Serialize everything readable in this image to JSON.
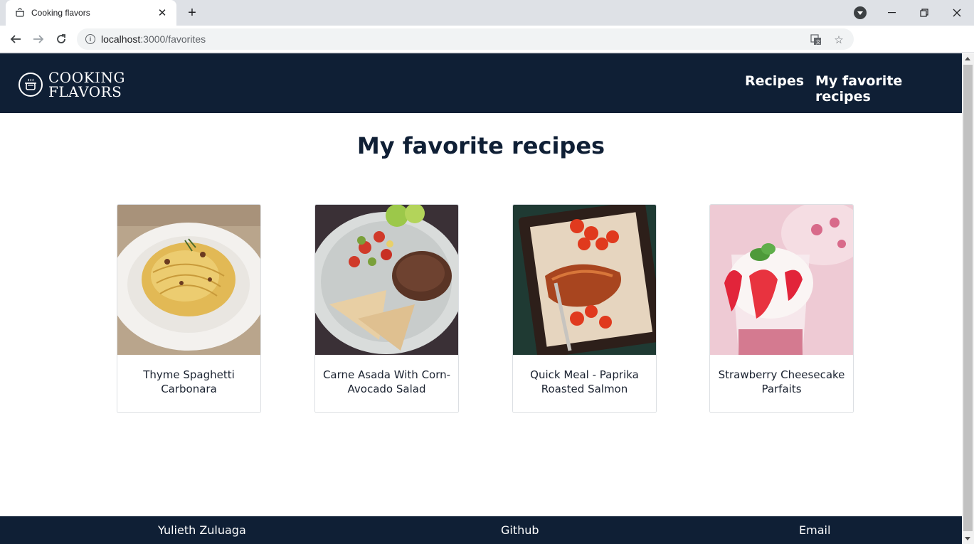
{
  "browser": {
    "tab_title": "Cooking flavors",
    "url_host": "localhost",
    "url_path": ":3000/favorites"
  },
  "header": {
    "logo_line1": "COOKING",
    "logo_line2": "FLAVORS",
    "nav": [
      "Recipes",
      "My favorite recipes"
    ]
  },
  "main": {
    "title": "My favorite recipes",
    "recipes": [
      {
        "name": "Thyme Spaghetti Carbonara"
      },
      {
        "name": "Carne Asada With Corn-Avocado Salad"
      },
      {
        "name": "Quick Meal - Paprika Roasted Salmon"
      },
      {
        "name": "Strawberry Cheesecake Parfaits"
      }
    ]
  },
  "footer": {
    "author": "Yulieth Zuluaga",
    "github": "Github",
    "email": "Email"
  },
  "colors": {
    "header_bg": "#0f1f35",
    "title_color": "#0f1f35"
  }
}
